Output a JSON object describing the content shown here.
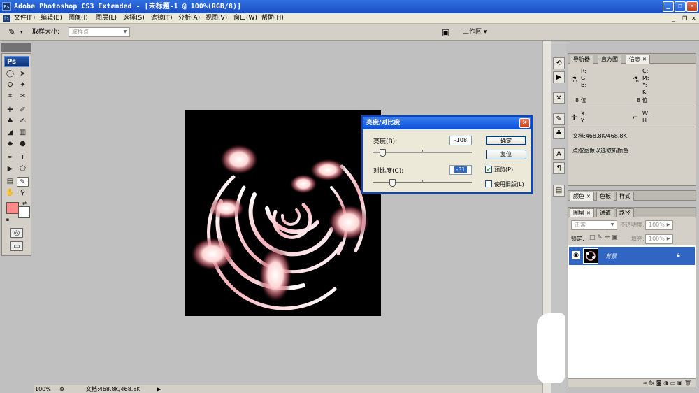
{
  "app": {
    "title": "Adobe Photoshop CS3 Extended - [未标题-1 @ 100%(RGB/8)]",
    "ps_icon": "Ps"
  },
  "menu": [
    {
      "label": "文件(F)"
    },
    {
      "label": "编辑(E)"
    },
    {
      "label": "图像(I)"
    },
    {
      "label": "图层(L)"
    },
    {
      "label": "选择(S)"
    },
    {
      "label": "滤镜(T)"
    },
    {
      "label": "分析(A)"
    },
    {
      "label": "视图(V)"
    },
    {
      "label": "窗口(W)"
    },
    {
      "label": "帮助(H)"
    }
  ],
  "options": {
    "sample_size_label": "取样大小:",
    "sample_size_value": "取样点",
    "workspace_label": "工作区 ▾"
  },
  "toolbox": {
    "logo": "Ps"
  },
  "status": {
    "zoom": "100%",
    "doc_info": "文档:468.8K/468.8K"
  },
  "dialog": {
    "title": "亮度/对比度",
    "brightness_label": "亮度(B):",
    "brightness_value": "-108",
    "contrast_label": "对比度(C):",
    "contrast_value": "-31",
    "brightness_fraction": 0.1,
    "contrast_fraction": 0.2,
    "ok_label": "确定",
    "reset_label": "复位",
    "preview_label": "预览(P)",
    "preview_checked": true,
    "legacy_label": "使用旧版(L)",
    "legacy_checked": false
  },
  "info_panel": {
    "tabs": [
      "导航器",
      "直方图",
      "信息"
    ],
    "r": "R:",
    "g": "G:",
    "b": "B:",
    "c": "C:",
    "m": "M:",
    "y": "Y:",
    "k": "K:",
    "bits_left": "8 位",
    "bits_right": "8 位",
    "x": "X:",
    "yy": "Y:",
    "w": "W:",
    "h": "H:",
    "doc": "文档:468.8K/468.8K",
    "hint": "点按图像以选取新颜色"
  },
  "color_panel": {
    "tabs": [
      "颜色",
      "色板",
      "样式"
    ]
  },
  "layers_panel": {
    "tabs": [
      "图层",
      "通道",
      "路径"
    ],
    "blend_mode": "正常",
    "opacity_label": "不透明度:",
    "opacity_value": "100%",
    "lock_label": "锁定:",
    "fill_label": "填充:",
    "fill_value": "100%",
    "layer_name": "背景"
  },
  "colors": {
    "foreground": "#ff8a8a",
    "background": "#ffffff",
    "title_blue": "#1b4fc0",
    "selected_layer": "#3165c4"
  }
}
